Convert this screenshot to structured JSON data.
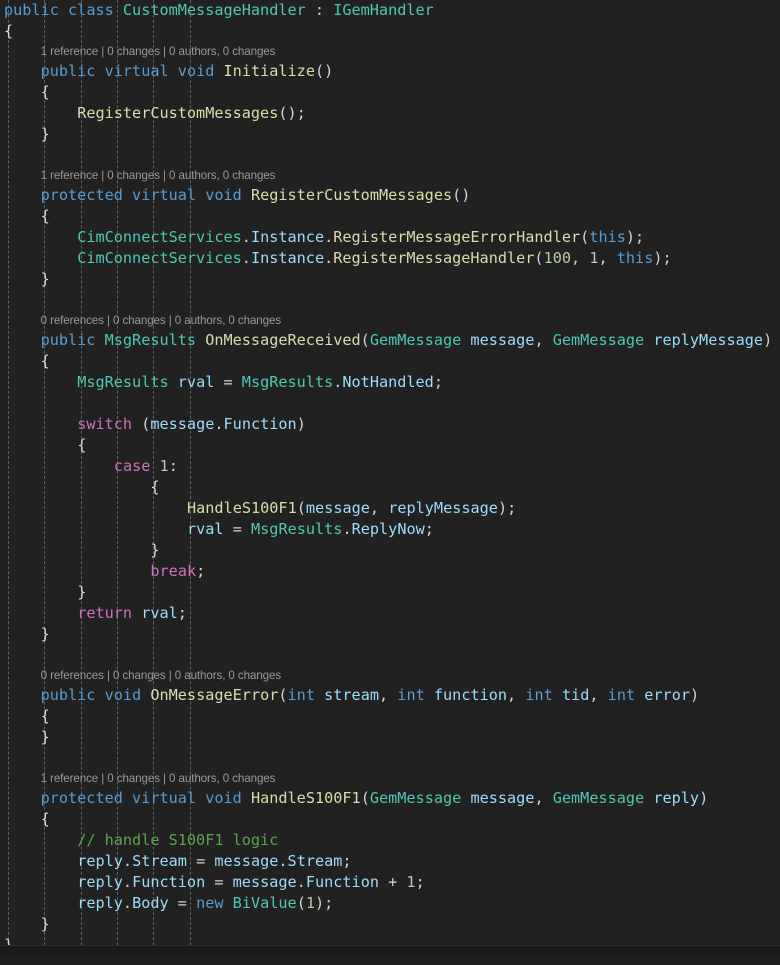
{
  "editor": {
    "language": "csharp",
    "background_color": "#212121",
    "theme": "dark",
    "colors": {
      "keyword": "#569cd6",
      "control_keyword": "#d070c0",
      "type": "#4ec9b0",
      "method": "#dcdcaa",
      "identifier": "#9cdcfe",
      "number": "#b5cea8",
      "comment": "#57a64a",
      "punctuation": "#d4d4d4",
      "codelens": "#9a9a9a"
    }
  },
  "codelens": {
    "one_reference": "1 reference | 0 changes | 0 authors, 0 changes",
    "zero_references": "0 references | 0 changes | 0 authors, 0 changes"
  },
  "lines": [
    {
      "id": "l1",
      "indent": 0,
      "type": "code",
      "tokens": [
        {
          "t": "public",
          "c": "kw"
        },
        {
          "t": " ",
          "c": "pun"
        },
        {
          "t": "class",
          "c": "kw"
        },
        {
          "t": " ",
          "c": "pun"
        },
        {
          "t": "CustomMessageHandler",
          "c": "type"
        },
        {
          "t": " : ",
          "c": "pun"
        },
        {
          "t": "IGemHandler",
          "c": "type"
        }
      ]
    },
    {
      "id": "l2",
      "indent": 0,
      "type": "code",
      "tokens": [
        {
          "t": "{",
          "c": "brc"
        }
      ]
    },
    {
      "id": "l3",
      "indent": 1,
      "type": "codelens",
      "text": "1 reference | 0 changes | 0 authors, 0 changes"
    },
    {
      "id": "l4",
      "indent": 1,
      "type": "code",
      "tokens": [
        {
          "t": "public",
          "c": "kw"
        },
        {
          "t": " ",
          "c": "pun"
        },
        {
          "t": "virtual",
          "c": "kw"
        },
        {
          "t": " ",
          "c": "pun"
        },
        {
          "t": "void",
          "c": "kw"
        },
        {
          "t": " ",
          "c": "pun"
        },
        {
          "t": "Initialize",
          "c": "fn"
        },
        {
          "t": "()",
          "c": "pun"
        }
      ]
    },
    {
      "id": "l5",
      "indent": 1,
      "type": "code",
      "tokens": [
        {
          "t": "{",
          "c": "brc"
        }
      ]
    },
    {
      "id": "l6",
      "indent": 2,
      "type": "code",
      "tokens": [
        {
          "t": "RegisterCustomMessages",
          "c": "fn"
        },
        {
          "t": "();",
          "c": "pun"
        }
      ]
    },
    {
      "id": "l7",
      "indent": 1,
      "type": "code",
      "tokens": [
        {
          "t": "}",
          "c": "brc"
        }
      ]
    },
    {
      "id": "l8",
      "indent": 0,
      "type": "blank",
      "tokens": []
    },
    {
      "id": "l9",
      "indent": 1,
      "type": "codelens",
      "text": "1 reference | 0 changes | 0 authors, 0 changes"
    },
    {
      "id": "l10",
      "indent": 1,
      "type": "code",
      "tokens": [
        {
          "t": "protected",
          "c": "kw"
        },
        {
          "t": " ",
          "c": "pun"
        },
        {
          "t": "virtual",
          "c": "kw"
        },
        {
          "t": " ",
          "c": "pun"
        },
        {
          "t": "void",
          "c": "kw"
        },
        {
          "t": " ",
          "c": "pun"
        },
        {
          "t": "RegisterCustomMessages",
          "c": "fn"
        },
        {
          "t": "()",
          "c": "pun"
        }
      ]
    },
    {
      "id": "l11",
      "indent": 1,
      "type": "code",
      "tokens": [
        {
          "t": "{",
          "c": "brc"
        }
      ]
    },
    {
      "id": "l12",
      "indent": 2,
      "type": "code",
      "tokens": [
        {
          "t": "CimConnectServices",
          "c": "type"
        },
        {
          "t": ".",
          "c": "pun"
        },
        {
          "t": "Instance",
          "c": "var"
        },
        {
          "t": ".",
          "c": "pun"
        },
        {
          "t": "RegisterMessageErrorHandler",
          "c": "fn"
        },
        {
          "t": "(",
          "c": "pun"
        },
        {
          "t": "this",
          "c": "kw"
        },
        {
          "t": ");",
          "c": "pun"
        }
      ]
    },
    {
      "id": "l13",
      "indent": 2,
      "type": "code",
      "tokens": [
        {
          "t": "CimConnectServices",
          "c": "type"
        },
        {
          "t": ".",
          "c": "pun"
        },
        {
          "t": "Instance",
          "c": "var"
        },
        {
          "t": ".",
          "c": "pun"
        },
        {
          "t": "RegisterMessageHandler",
          "c": "fn"
        },
        {
          "t": "(",
          "c": "pun"
        },
        {
          "t": "100",
          "c": "num"
        },
        {
          "t": ", ",
          "c": "pun"
        },
        {
          "t": "1",
          "c": "num"
        },
        {
          "t": ", ",
          "c": "pun"
        },
        {
          "t": "this",
          "c": "kw"
        },
        {
          "t": ");",
          "c": "pun"
        }
      ]
    },
    {
      "id": "l14",
      "indent": 1,
      "type": "code",
      "tokens": [
        {
          "t": "}",
          "c": "brc"
        }
      ]
    },
    {
      "id": "l15",
      "indent": 0,
      "type": "blank",
      "tokens": []
    },
    {
      "id": "l16",
      "indent": 1,
      "type": "codelens",
      "text": "0 references | 0 changes | 0 authors, 0 changes"
    },
    {
      "id": "l17",
      "indent": 1,
      "type": "code",
      "tokens": [
        {
          "t": "public",
          "c": "kw"
        },
        {
          "t": " ",
          "c": "pun"
        },
        {
          "t": "MsgResults",
          "c": "type"
        },
        {
          "t": " ",
          "c": "pun"
        },
        {
          "t": "OnMessageReceived",
          "c": "fn"
        },
        {
          "t": "(",
          "c": "pun"
        },
        {
          "t": "GemMessage",
          "c": "type"
        },
        {
          "t": " ",
          "c": "pun"
        },
        {
          "t": "message",
          "c": "var"
        },
        {
          "t": ", ",
          "c": "pun"
        },
        {
          "t": "GemMessage",
          "c": "type"
        },
        {
          "t": " ",
          "c": "pun"
        },
        {
          "t": "replyMessage",
          "c": "var"
        },
        {
          "t": ")",
          "c": "pun"
        }
      ]
    },
    {
      "id": "l18",
      "indent": 1,
      "type": "code",
      "tokens": [
        {
          "t": "{",
          "c": "brc"
        }
      ]
    },
    {
      "id": "l19",
      "indent": 2,
      "type": "code",
      "tokens": [
        {
          "t": "MsgResults",
          "c": "type"
        },
        {
          "t": " ",
          "c": "pun"
        },
        {
          "t": "rval",
          "c": "var"
        },
        {
          "t": " = ",
          "c": "pun"
        },
        {
          "t": "MsgResults",
          "c": "type"
        },
        {
          "t": ".",
          "c": "pun"
        },
        {
          "t": "NotHandled",
          "c": "var"
        },
        {
          "t": ";",
          "c": "pun"
        }
      ]
    },
    {
      "id": "l20",
      "indent": 0,
      "type": "blank",
      "tokens": []
    },
    {
      "id": "l21",
      "indent": 2,
      "type": "code",
      "tokens": [
        {
          "t": "switch",
          "c": "ctl"
        },
        {
          "t": " (",
          "c": "pun"
        },
        {
          "t": "message",
          "c": "var"
        },
        {
          "t": ".",
          "c": "pun"
        },
        {
          "t": "Function",
          "c": "var"
        },
        {
          "t": ")",
          "c": "pun"
        }
      ]
    },
    {
      "id": "l22",
      "indent": 2,
      "type": "code",
      "tokens": [
        {
          "t": "{",
          "c": "brc"
        }
      ]
    },
    {
      "id": "l23",
      "indent": 3,
      "type": "code",
      "tokens": [
        {
          "t": "case",
          "c": "ctl"
        },
        {
          "t": " ",
          "c": "pun"
        },
        {
          "t": "1",
          "c": "num"
        },
        {
          "t": ":",
          "c": "pun"
        }
      ]
    },
    {
      "id": "l24",
      "indent": 4,
      "type": "code",
      "tokens": [
        {
          "t": "{",
          "c": "brc"
        }
      ]
    },
    {
      "id": "l25",
      "indent": 5,
      "type": "code",
      "tokens": [
        {
          "t": "HandleS100F1",
          "c": "fn"
        },
        {
          "t": "(",
          "c": "pun"
        },
        {
          "t": "message",
          "c": "var"
        },
        {
          "t": ", ",
          "c": "pun"
        },
        {
          "t": "replyMessage",
          "c": "var"
        },
        {
          "t": ");",
          "c": "pun"
        }
      ]
    },
    {
      "id": "l26",
      "indent": 5,
      "type": "code",
      "tokens": [
        {
          "t": "rval",
          "c": "var"
        },
        {
          "t": " = ",
          "c": "pun"
        },
        {
          "t": "MsgResults",
          "c": "type"
        },
        {
          "t": ".",
          "c": "pun"
        },
        {
          "t": "ReplyNow",
          "c": "var"
        },
        {
          "t": ";",
          "c": "pun"
        }
      ]
    },
    {
      "id": "l27",
      "indent": 4,
      "type": "code",
      "tokens": [
        {
          "t": "}",
          "c": "brc"
        }
      ]
    },
    {
      "id": "l28",
      "indent": 4,
      "type": "code",
      "tokens": [
        {
          "t": "break",
          "c": "ctl"
        },
        {
          "t": ";",
          "c": "pun"
        }
      ]
    },
    {
      "id": "l29",
      "indent": 2,
      "type": "code",
      "tokens": [
        {
          "t": "}",
          "c": "brc"
        }
      ]
    },
    {
      "id": "l30",
      "indent": 2,
      "type": "code",
      "tokens": [
        {
          "t": "return",
          "c": "ctl"
        },
        {
          "t": " ",
          "c": "pun"
        },
        {
          "t": "rval",
          "c": "var"
        },
        {
          "t": ";",
          "c": "pun"
        }
      ]
    },
    {
      "id": "l31",
      "indent": 1,
      "type": "code",
      "tokens": [
        {
          "t": "}",
          "c": "brc"
        }
      ]
    },
    {
      "id": "l32",
      "indent": 0,
      "type": "blank",
      "tokens": []
    },
    {
      "id": "l33",
      "indent": 1,
      "type": "codelens",
      "text": "0 references | 0 changes | 0 authors, 0 changes"
    },
    {
      "id": "l34",
      "indent": 1,
      "type": "code",
      "tokens": [
        {
          "t": "public",
          "c": "kw"
        },
        {
          "t": " ",
          "c": "pun"
        },
        {
          "t": "void",
          "c": "kw"
        },
        {
          "t": " ",
          "c": "pun"
        },
        {
          "t": "OnMessageError",
          "c": "fn"
        },
        {
          "t": "(",
          "c": "pun"
        },
        {
          "t": "int",
          "c": "kw"
        },
        {
          "t": " ",
          "c": "pun"
        },
        {
          "t": "stream",
          "c": "var"
        },
        {
          "t": ", ",
          "c": "pun"
        },
        {
          "t": "int",
          "c": "kw"
        },
        {
          "t": " ",
          "c": "pun"
        },
        {
          "t": "function",
          "c": "var"
        },
        {
          "t": ", ",
          "c": "pun"
        },
        {
          "t": "int",
          "c": "kw"
        },
        {
          "t": " ",
          "c": "pun"
        },
        {
          "t": "tid",
          "c": "var"
        },
        {
          "t": ", ",
          "c": "pun"
        },
        {
          "t": "int",
          "c": "kw"
        },
        {
          "t": " ",
          "c": "pun"
        },
        {
          "t": "error",
          "c": "var"
        },
        {
          "t": ")",
          "c": "pun"
        }
      ]
    },
    {
      "id": "l35",
      "indent": 1,
      "type": "code",
      "tokens": [
        {
          "t": "{",
          "c": "brc"
        }
      ]
    },
    {
      "id": "l36",
      "indent": 1,
      "type": "code",
      "tokens": [
        {
          "t": "}",
          "c": "brc"
        }
      ]
    },
    {
      "id": "l37",
      "indent": 0,
      "type": "blank",
      "tokens": []
    },
    {
      "id": "l38",
      "indent": 1,
      "type": "codelens",
      "text": "1 reference | 0 changes | 0 authors, 0 changes"
    },
    {
      "id": "l39",
      "indent": 1,
      "type": "code",
      "tokens": [
        {
          "t": "protected",
          "c": "kw"
        },
        {
          "t": " ",
          "c": "pun"
        },
        {
          "t": "virtual",
          "c": "kw"
        },
        {
          "t": " ",
          "c": "pun"
        },
        {
          "t": "void",
          "c": "kw"
        },
        {
          "t": " ",
          "c": "pun"
        },
        {
          "t": "HandleS100F1",
          "c": "fn"
        },
        {
          "t": "(",
          "c": "pun"
        },
        {
          "t": "GemMessage",
          "c": "type"
        },
        {
          "t": " ",
          "c": "pun"
        },
        {
          "t": "message",
          "c": "var"
        },
        {
          "t": ", ",
          "c": "pun"
        },
        {
          "t": "GemMessage",
          "c": "type"
        },
        {
          "t": " ",
          "c": "pun"
        },
        {
          "t": "reply",
          "c": "var"
        },
        {
          "t": ")",
          "c": "pun"
        }
      ]
    },
    {
      "id": "l40",
      "indent": 1,
      "type": "code",
      "tokens": [
        {
          "t": "{",
          "c": "brc"
        }
      ]
    },
    {
      "id": "l41",
      "indent": 2,
      "type": "code",
      "tokens": [
        {
          "t": "// handle S100F1 logic",
          "c": "cmt"
        }
      ]
    },
    {
      "id": "l42",
      "indent": 2,
      "type": "code",
      "tokens": [
        {
          "t": "reply",
          "c": "var"
        },
        {
          "t": ".",
          "c": "pun"
        },
        {
          "t": "Stream",
          "c": "var"
        },
        {
          "t": " = ",
          "c": "pun"
        },
        {
          "t": "message",
          "c": "var"
        },
        {
          "t": ".",
          "c": "pun"
        },
        {
          "t": "Stream",
          "c": "var"
        },
        {
          "t": ";",
          "c": "pun"
        }
      ]
    },
    {
      "id": "l43",
      "indent": 2,
      "type": "code",
      "tokens": [
        {
          "t": "reply",
          "c": "var"
        },
        {
          "t": ".",
          "c": "pun"
        },
        {
          "t": "Function",
          "c": "var"
        },
        {
          "t": " = ",
          "c": "pun"
        },
        {
          "t": "message",
          "c": "var"
        },
        {
          "t": ".",
          "c": "pun"
        },
        {
          "t": "Function",
          "c": "var"
        },
        {
          "t": " + ",
          "c": "pun"
        },
        {
          "t": "1",
          "c": "num"
        },
        {
          "t": ";",
          "c": "pun"
        }
      ]
    },
    {
      "id": "l44",
      "indent": 2,
      "type": "code",
      "tokens": [
        {
          "t": "reply",
          "c": "var"
        },
        {
          "t": ".",
          "c": "pun"
        },
        {
          "t": "Body",
          "c": "var"
        },
        {
          "t": " = ",
          "c": "pun"
        },
        {
          "t": "new",
          "c": "kw"
        },
        {
          "t": " ",
          "c": "pun"
        },
        {
          "t": "BiValue",
          "c": "type"
        },
        {
          "t": "(",
          "c": "pun"
        },
        {
          "t": "1",
          "c": "num"
        },
        {
          "t": ");",
          "c": "pun"
        }
      ]
    },
    {
      "id": "l45",
      "indent": 1,
      "type": "code",
      "tokens": [
        {
          "t": "}",
          "c": "brc"
        }
      ]
    },
    {
      "id": "l46",
      "indent": 0,
      "type": "code",
      "tokens": [
        {
          "t": "}",
          "c": "brc"
        }
      ]
    }
  ],
  "indent_guides": [
    8,
    44,
    81,
    117,
    153,
    190
  ]
}
